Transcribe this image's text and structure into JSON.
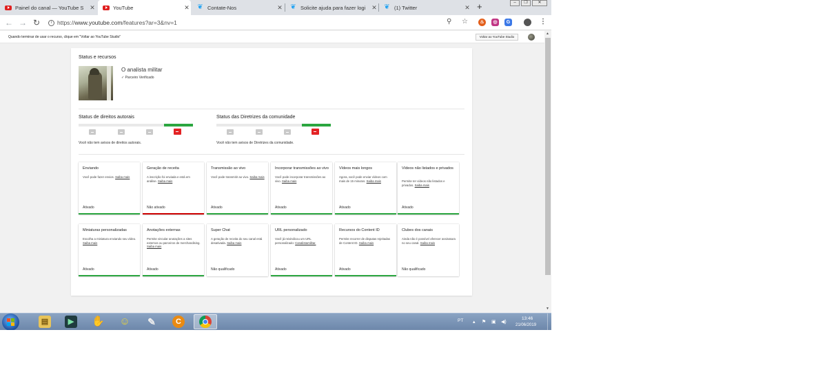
{
  "browser": {
    "tabs": [
      {
        "title": "Painel do canal — YouTube S",
        "favicon": "youtube-icon",
        "active": false
      },
      {
        "title": "YouTube",
        "favicon": "youtube-icon",
        "active": true
      },
      {
        "title": "Contate-Nos",
        "favicon": "twitter-icon",
        "active": false
      },
      {
        "title": "Solicite ajuda para fazer logi",
        "favicon": "twitter-icon",
        "active": false
      },
      {
        "title": "(1) Twitter",
        "favicon": "twitter-icon",
        "active": false
      }
    ],
    "new_tab": "+",
    "url_scheme": "https://",
    "url_host": "www.youtube.com",
    "url_path": "/features?ar=3&nv=1"
  },
  "return_bar": {
    "message": "Quando terminar de usar o recurso, clique em \"Voltar ao YouTube Studio\"",
    "button": "Voltar ao YouTube Studio"
  },
  "status": {
    "title": "Status e recursos",
    "channel_name": "O analista militar",
    "verified_label": "Parceiro Verificado",
    "copyright": {
      "title": "Status de direitos autorais",
      "note": "Você não tem avisos de direitos autorais."
    },
    "community": {
      "title": "Status das Diretrizes da comunidade",
      "note": "Você não tem avisos de Diretrizes da comunidade."
    }
  },
  "features": [
    {
      "title": "Enviando",
      "desc": "Você pode fazer envios.",
      "learn": "Saiba mais",
      "status": "Ativado",
      "bar": "green"
    },
    {
      "title": "Geração de receita",
      "desc": "A inscrição foi enviada e está em análise.",
      "learn": "Saiba mais",
      "status": "Não ativado",
      "bar": "red"
    },
    {
      "title": "Transmissão ao vivo",
      "desc": "Você pode transmitir ao vivo.",
      "learn": "Saiba mais",
      "status": "Ativado",
      "bar": "green"
    },
    {
      "title": "Incorporar transmissões ao vivo",
      "desc": "Você pode incorporar transmissões ao vivo.",
      "learn": "Saiba mais",
      "status": "Ativado",
      "bar": "green"
    },
    {
      "title": "Vídeos mais longos",
      "desc": "Agora, você pode enviar vídeos com mais de 15 minutos.",
      "learn": "Saiba mais",
      "status": "Ativado",
      "bar": "green"
    },
    {
      "title": "Vídeos não listados e privados",
      "desc": "Permite ter vídeos não listados e privados.",
      "learn": "Saiba mais",
      "status": "Ativado",
      "bar": "green"
    },
    {
      "title": "Miniaturas personalizadas",
      "desc": "Escolha a miniatura enviando seu vídeo.",
      "learn": "Saiba mais",
      "status": "Ativado",
      "bar": "green"
    },
    {
      "title": "Anotações externas",
      "desc": "Permite vincular anotações a sites externos ou parceiros de merchandising.",
      "learn": "Saiba mais",
      "status": "Ativado",
      "bar": "green"
    },
    {
      "title": "Super Chat",
      "desc": "A geração de receita do seu canal está desativada.",
      "learn": "Saiba mais",
      "status": "Não qualificado",
      "bar": "none"
    },
    {
      "title": "URL personalizado",
      "desc": "Você já reivindicou um URL personalizado:",
      "learn": "Canalistamilitar.",
      "status": "Ativado",
      "bar": "green"
    },
    {
      "title": "Recursos do Content ID",
      "desc": "Permite recorrer de disputas rejeitadas de Content ID.",
      "learn": "Saiba mais",
      "status": "Ativado",
      "bar": "green"
    },
    {
      "title": "Clubes dos canais",
      "desc": "Ainda não é possível oferecer assinatura no seu canal.",
      "learn": "Saiba mais",
      "status": "Não qualificado",
      "bar": "none"
    }
  ],
  "taskbar": {
    "language": "PT",
    "time": "13:46",
    "date": "21/06/2019"
  }
}
